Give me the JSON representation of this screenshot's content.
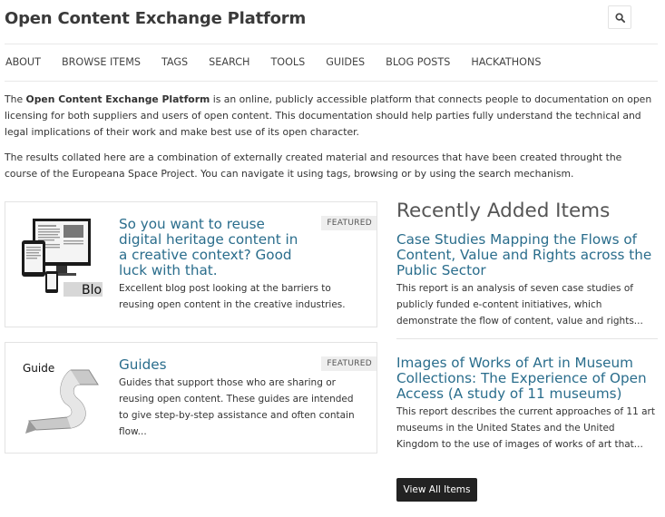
{
  "header": {
    "site_title": "Open Content Exchange Platform",
    "search_icon": "search-icon"
  },
  "nav": {
    "items": [
      {
        "label": "ABOUT"
      },
      {
        "label": "BROWSE ITEMS"
      },
      {
        "label": "TAGS"
      },
      {
        "label": "SEARCH"
      },
      {
        "label": "TOOLS"
      },
      {
        "label": "GUIDES"
      },
      {
        "label": "BLOG POSTS"
      },
      {
        "label": "HACKATHONS"
      }
    ]
  },
  "intro": {
    "p1_pre": "The ",
    "p1_bold": "Open Content Exchange Platform",
    "p1_post": " is an online, publicly accessible platform that connects people to documentation on open licensing for both suppliers and users of open content. This documentation should help parties fully understand the technical and legal implications of their work and make best use of its open character.",
    "p2": "The results collated here are a combination of externally created material and resources that have been created throught the course of the Europeana Space Project. You can navigate it using tags, browsing or by using the search mechanism."
  },
  "featured": [
    {
      "badge": "FEATURED",
      "title": "So you want to reuse digital heritage content in a creative context? Good luck with that.",
      "description": "Excellent blog post looking at the barriers to reusing open content in the creative industries.",
      "image_label": "Blo"
    },
    {
      "badge": "FEATURED",
      "title": "Guides",
      "description": "Guides that support those who are sharing or reusing open content. These guides are intended to give step-by-step assistance and often contain flow...",
      "image_label": "Guide"
    }
  ],
  "recent": {
    "heading": "Recently Added Items",
    "items": [
      {
        "title": "Case Studies Mapping the Flows of Content, Value and Rights across the Public Sector",
        "description": "This report is an analysis of seven case studies of publicly funded e-content initiatives, which demonstrate the flow of content, value and rights..."
      },
      {
        "title": "Images of Works of Art in Museum Collections: The Experience of Open Access (A study of 11 museums)",
        "description": "This report describes the current approaches of 11 art museums in the United States and the United Kingdom to the use of images of works of art that..."
      }
    ],
    "view_all_label": "View All Items"
  },
  "colors": {
    "link": "#2a6d8c",
    "button_bg": "#222222",
    "badge_bg": "#eeeeee"
  }
}
